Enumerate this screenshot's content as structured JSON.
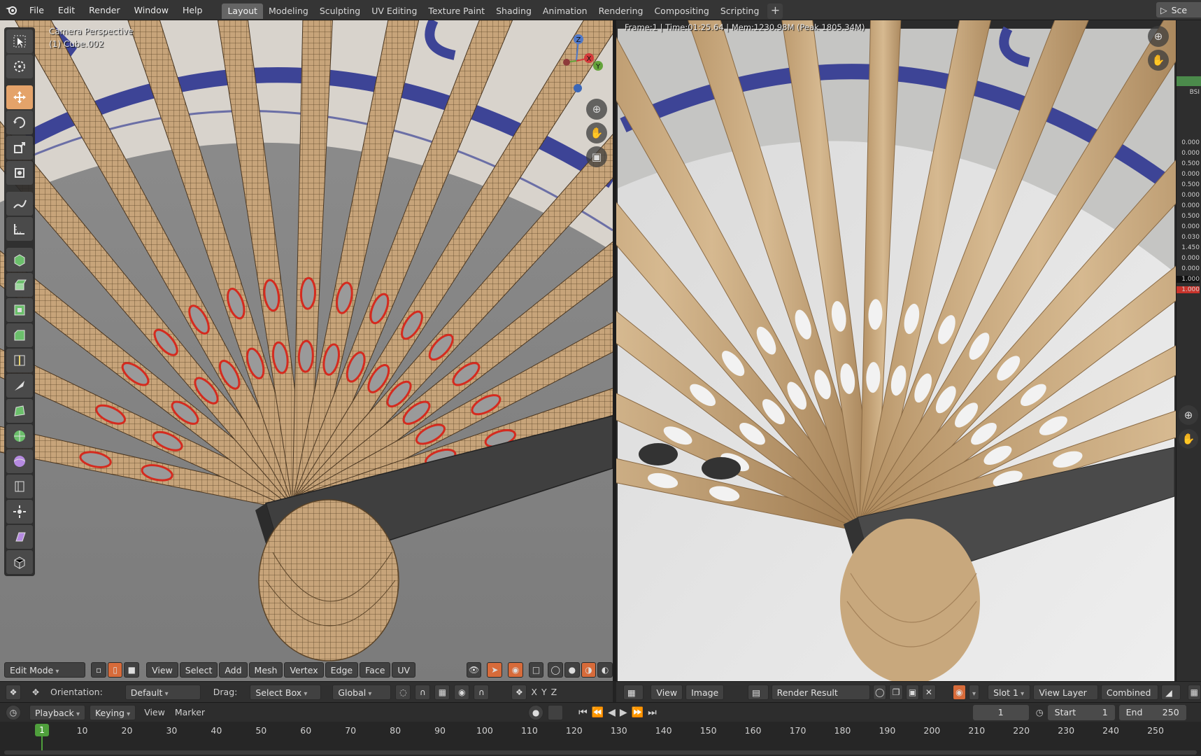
{
  "topbar": {
    "menus": [
      "File",
      "Edit",
      "Render",
      "Window",
      "Help"
    ],
    "workspaces": [
      "Layout",
      "Modeling",
      "Sculpting",
      "UV Editing",
      "Texture Paint",
      "Shading",
      "Animation",
      "Rendering",
      "Compositing",
      "Scripting"
    ],
    "active_workspace": "Layout",
    "add_label": "+",
    "scene_label": "Sce"
  },
  "viewport3d": {
    "overlay_line1": "Camera Perspective",
    "overlay_line2": "(1) Cube.002",
    "mode": "Edit Mode",
    "header_menus": [
      "View",
      "Select",
      "Add",
      "Mesh",
      "Vertex",
      "Edge",
      "Face",
      "UV"
    ],
    "gizmo_axes": {
      "x": "X",
      "y": "Y",
      "z": "Z"
    }
  },
  "tool_settings": {
    "orientation_label": "Orientation:",
    "orientation_value": "Default",
    "drag_label": "Drag:",
    "drag_value": "Select Box",
    "transform_value": "Global",
    "axes": [
      "X",
      "Y",
      "Z"
    ]
  },
  "image_editor": {
    "status": "Frame:1 | Time:01:25.64 | Mem:1230.98M (Peak 1805.34M)",
    "menus": [
      "View",
      "Image"
    ],
    "image_name": "Render Result",
    "slot": "Slot 1",
    "view_layer": "View Layer",
    "pass": "Combined"
  },
  "right_panel": {
    "label_top": "BSI",
    "values": [
      "0.000",
      "0.000",
      "0.500",
      "0.000",
      "0.500",
      "0.000",
      "0.000",
      "0.500",
      "0.000",
      "0.030",
      "1.450",
      "0.000",
      "0.000",
      "1.000",
      "1.000"
    ]
  },
  "timeline": {
    "menus": [
      "Playback",
      "Keying",
      "View",
      "Marker"
    ],
    "current_frame": "1",
    "start_label": "Start",
    "start_value": "1",
    "end_label": "End",
    "end_value": "250",
    "ruler": [
      "1",
      "10",
      "20",
      "30",
      "40",
      "50",
      "60",
      "70",
      "80",
      "90",
      "100",
      "110",
      "120",
      "130",
      "140",
      "150",
      "160",
      "170",
      "180",
      "190",
      "200",
      "210",
      "220",
      "230",
      "240",
      "250"
    ]
  },
  "colors": {
    "wood": "#c9a77c",
    "wood_dark": "#a98458",
    "cloth_blue": "#3d4496",
    "selection_red": "#d42b1f",
    "active_tool": "#e4a36a",
    "frame_green": "#4f9f3c"
  }
}
